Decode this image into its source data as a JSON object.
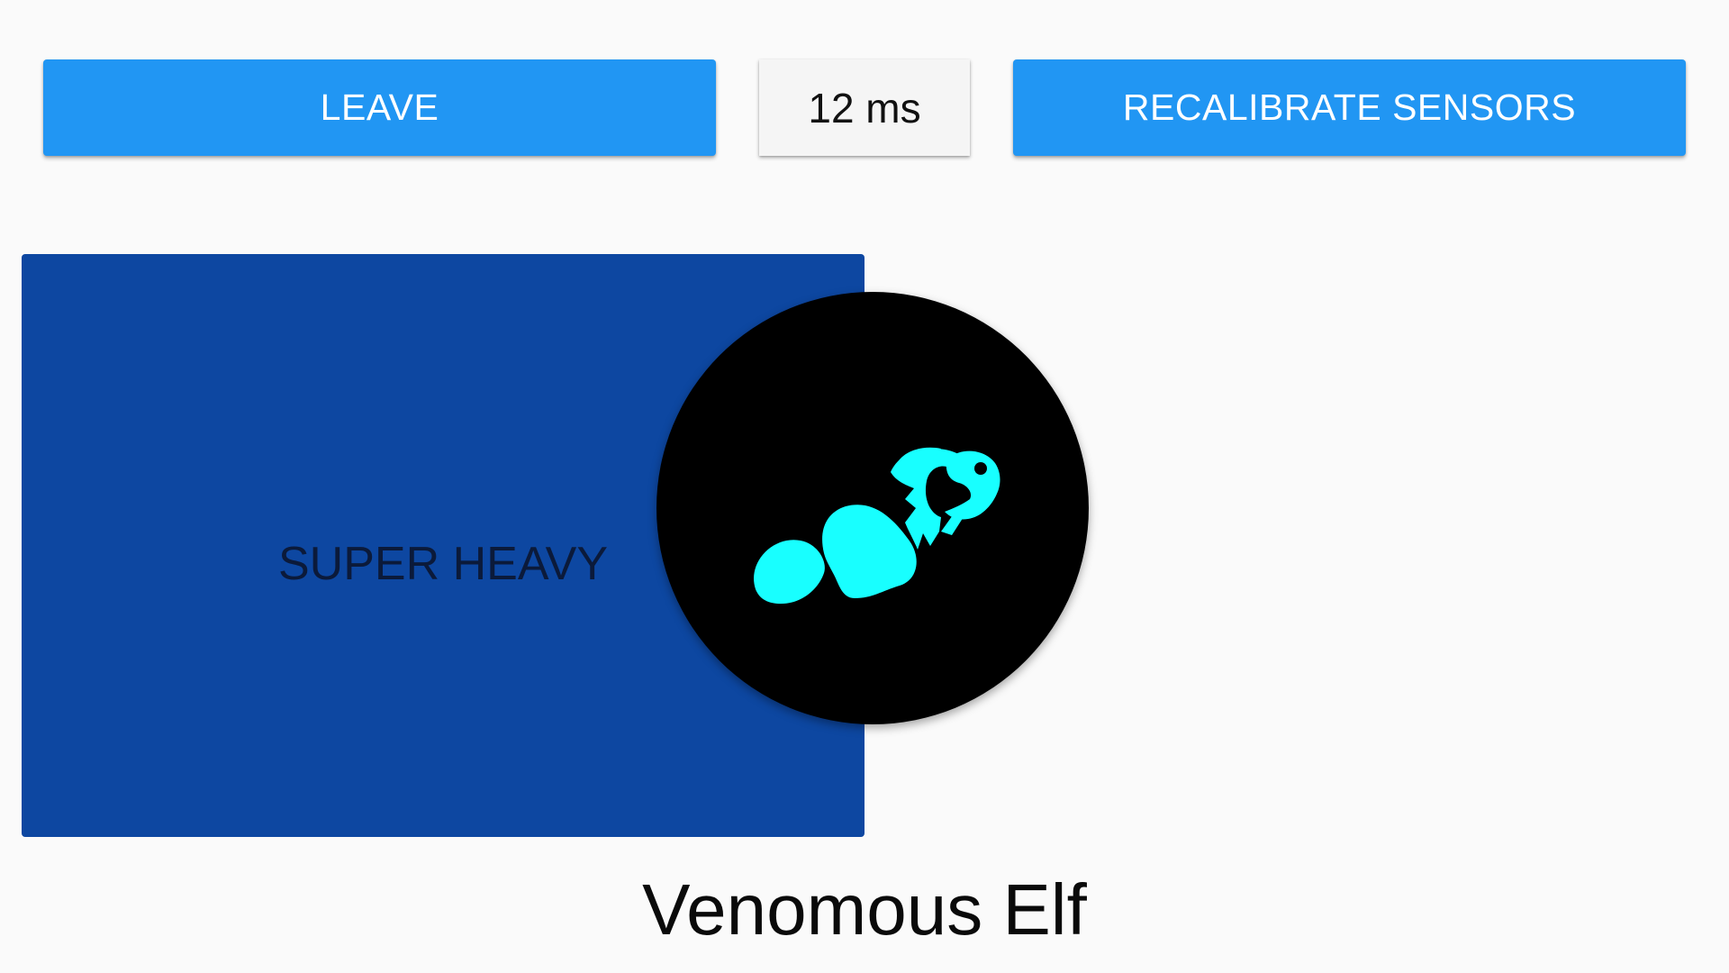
{
  "header": {
    "leave_label": "LEAVE",
    "latency_text": "12 ms",
    "recalibrate_label": "RECALIBRATE SENSORS"
  },
  "player": {
    "weight_class": "SUPER HEAVY",
    "name": "Venomous Elf",
    "avatar_icon": "clownfish-icon"
  },
  "colors": {
    "button_blue": "#2196F3",
    "panel_blue": "#0D47A1",
    "avatar_bg": "#000000",
    "avatar_icon": "#18FFFF"
  }
}
